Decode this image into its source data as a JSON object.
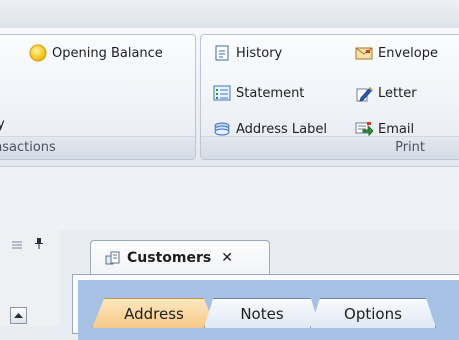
{
  "ribbon": {
    "transactions_group": {
      "caption": "nsactions",
      "opening_balance_label": "Opening Balance",
      "opening_balance_underline": "B",
      "fragment_text": "y"
    },
    "print_group": {
      "caption": "Print",
      "history_label": "History",
      "envelope_label": "Envelope",
      "statement_label": "Statement",
      "letter_label": "Letter",
      "address_label_label": "Address Label",
      "email_label": "Email"
    }
  },
  "document": {
    "tab_title": "Customers",
    "close_glyph": "✕",
    "pin_glyph": "ᵖ",
    "tabs": [
      "Address",
      "Notes",
      "Options"
    ]
  },
  "colors": {
    "active_tab": "#f8c989",
    "tab_strip": "#a6c1e4",
    "ribbon_border": "#bdc6d2"
  }
}
